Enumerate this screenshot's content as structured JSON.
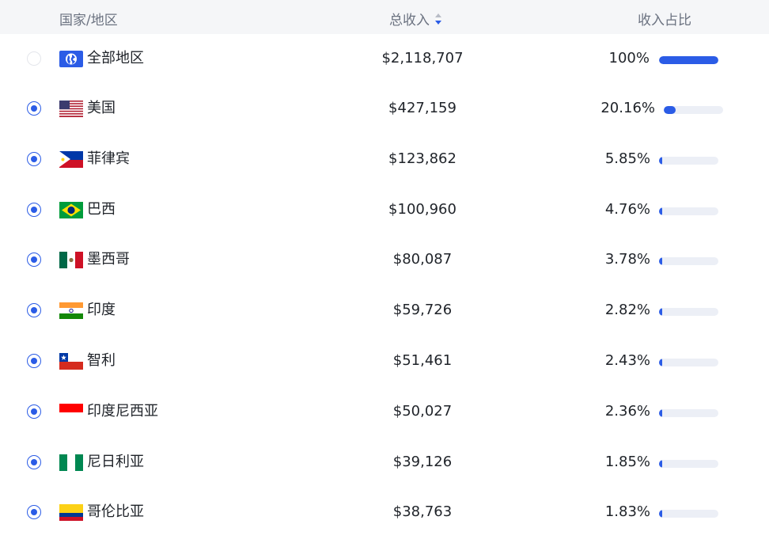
{
  "header": {
    "country_label": "国家/地区",
    "revenue_label": "总收入",
    "share_label": "收入占比"
  },
  "colors": {
    "accent": "#2b5ce6",
    "header_bg": "#f5f6f8",
    "bar_track": "#eceff6"
  },
  "rows": [
    {
      "name": "全部地区",
      "revenue": "$2,118,707",
      "share": "100%",
      "share_value": 1.0,
      "selected": false,
      "flag": "globe-icon"
    },
    {
      "name": "美国",
      "revenue": "$427,159",
      "share": "20.16%",
      "share_value": 0.2016,
      "selected": true,
      "flag": "us-flag-icon"
    },
    {
      "name": "菲律宾",
      "revenue": "$123,862",
      "share": "5.85%",
      "share_value": 0.0585,
      "selected": true,
      "flag": "ph-flag-icon"
    },
    {
      "name": "巴西",
      "revenue": "$100,960",
      "share": "4.76%",
      "share_value": 0.0476,
      "selected": true,
      "flag": "br-flag-icon"
    },
    {
      "name": "墨西哥",
      "revenue": "$80,087",
      "share": "3.78%",
      "share_value": 0.0378,
      "selected": true,
      "flag": "mx-flag-icon"
    },
    {
      "name": "印度",
      "revenue": "$59,726",
      "share": "2.82%",
      "share_value": 0.0282,
      "selected": true,
      "flag": "in-flag-icon"
    },
    {
      "name": "智利",
      "revenue": "$51,461",
      "share": "2.43%",
      "share_value": 0.0243,
      "selected": true,
      "flag": "cl-flag-icon"
    },
    {
      "name": "印度尼西亚",
      "revenue": "$50,027",
      "share": "2.36%",
      "share_value": 0.0236,
      "selected": true,
      "flag": "id-flag-icon"
    },
    {
      "name": "尼日利亚",
      "revenue": "$39,126",
      "share": "1.85%",
      "share_value": 0.0185,
      "selected": true,
      "flag": "ng-flag-icon"
    },
    {
      "name": "哥伦比亚",
      "revenue": "$38,763",
      "share": "1.83%",
      "share_value": 0.0183,
      "selected": true,
      "flag": "co-flag-icon"
    }
  ]
}
